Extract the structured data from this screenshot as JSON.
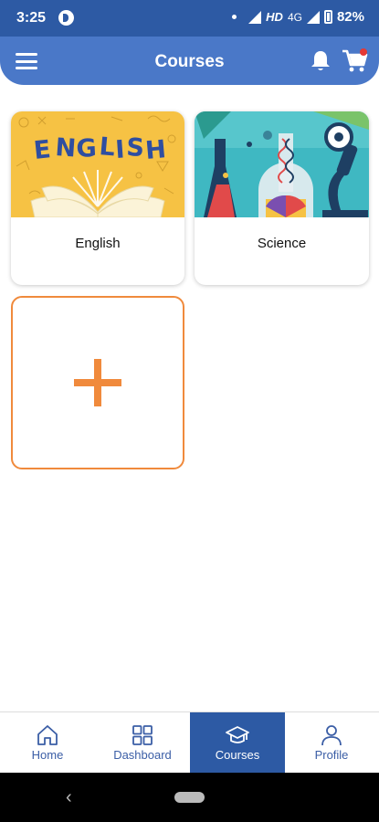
{
  "status_bar": {
    "time": "3:25",
    "network_hd": "HD",
    "network_type": "4G",
    "battery": "82%"
  },
  "app_bar": {
    "title": "Courses",
    "menu_icon": "hamburger-menu-icon",
    "notification_icon": "bell-icon",
    "cart_icon": "cart-icon",
    "cart_badge_color": "#e53935"
  },
  "courses": [
    {
      "label": "English",
      "image": "english-book-illustration"
    },
    {
      "label": "Science",
      "image": "science-lab-illustration"
    }
  ],
  "add_course": {
    "icon": "plus-icon",
    "color": "#f08a3c"
  },
  "bottom_nav": {
    "items": [
      {
        "label": "Home",
        "icon": "home-icon"
      },
      {
        "label": "Dashboard",
        "icon": "dashboard-icon"
      },
      {
        "label": "Courses",
        "icon": "graduation-cap-icon",
        "active": true
      },
      {
        "label": "Profile",
        "icon": "person-icon"
      }
    ]
  },
  "theme": {
    "primary": "#2d5aa4",
    "appbar": "#4a78c8",
    "accent": "#f08a3c"
  }
}
